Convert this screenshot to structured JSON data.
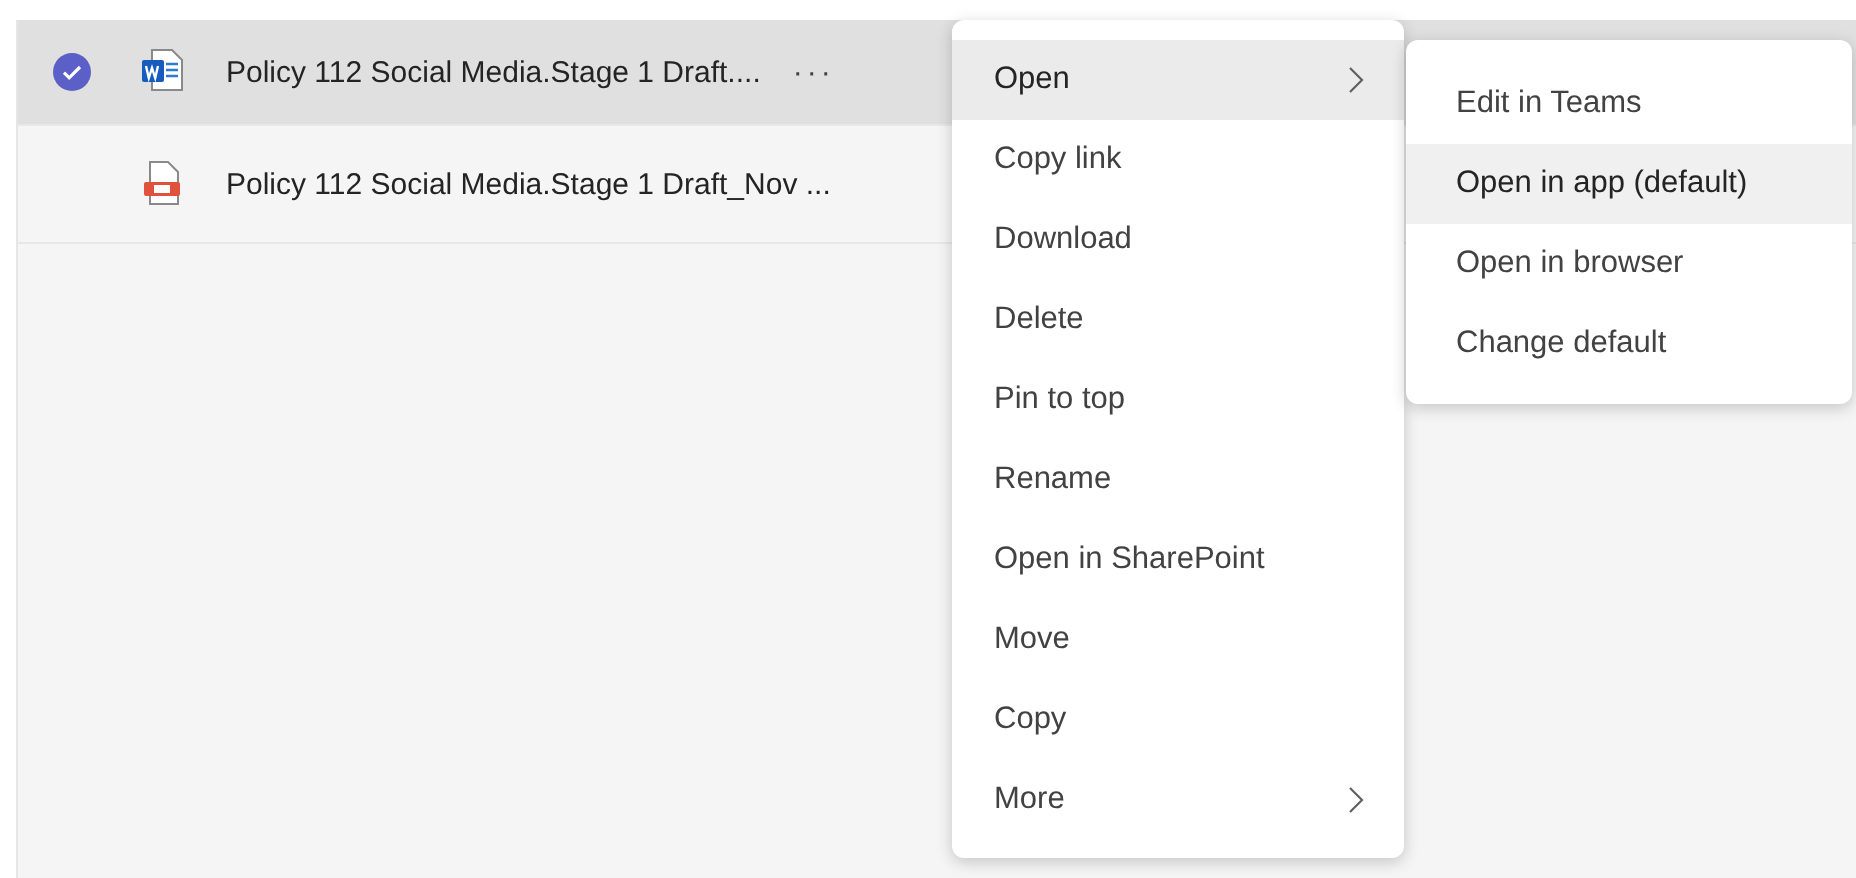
{
  "files": [
    {
      "name": "Policy 112 Social Media.Stage 1 Draft....",
      "kind": "word",
      "selected": true,
      "more": "···"
    },
    {
      "name": "Policy 112 Social Media.Stage 1 Draft_Nov ...",
      "kind": "pdf",
      "selected": false
    }
  ],
  "context_menu": [
    {
      "label": "Open",
      "highlighted": true,
      "submenu": true
    },
    {
      "label": "Copy link",
      "highlighted": false,
      "submenu": false
    },
    {
      "label": "Download",
      "highlighted": false,
      "submenu": false
    },
    {
      "label": "Delete",
      "highlighted": false,
      "submenu": false
    },
    {
      "label": "Pin to top",
      "highlighted": false,
      "submenu": false
    },
    {
      "label": "Rename",
      "highlighted": false,
      "submenu": false
    },
    {
      "label": "Open in SharePoint",
      "highlighted": false,
      "submenu": false
    },
    {
      "label": "Move",
      "highlighted": false,
      "submenu": false
    },
    {
      "label": "Copy",
      "highlighted": false,
      "submenu": false
    },
    {
      "label": "More",
      "highlighted": false,
      "submenu": true
    }
  ],
  "submenu": [
    {
      "label": "Edit in Teams",
      "highlighted": false
    },
    {
      "label": "Open in app (default)",
      "highlighted": true
    },
    {
      "label": "Open in browser",
      "highlighted": false
    },
    {
      "label": "Change default",
      "highlighted": false
    }
  ]
}
